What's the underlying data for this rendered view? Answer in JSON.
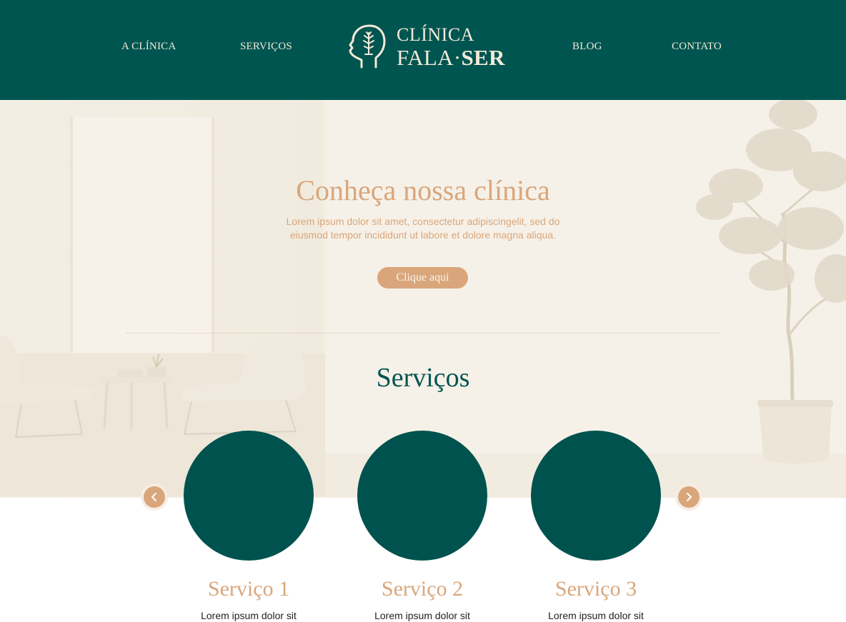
{
  "nav": {
    "items": [
      {
        "label": "A CLÍNICA"
      },
      {
        "label": "SERVIÇOS"
      },
      {
        "label": "BLOG"
      },
      {
        "label": "CONTATO"
      }
    ]
  },
  "logo": {
    "line1": "CLÍNICA",
    "line2_a": "FALA·",
    "line2_b": "SER",
    "icon": "head-with-tree-icon"
  },
  "hero": {
    "title": "Conheça nossa clínica",
    "text": "Lorem ipsum dolor sit amet, consectetur adipiscingelit, sed do eiusmod tempor incididunt ut labore et dolore magna aliqua.",
    "button_label": "Clique aqui"
  },
  "services": {
    "title": "Serviços",
    "items": [
      {
        "title": "Serviço 1",
        "text": "Lorem ipsum dolor sit"
      },
      {
        "title": "Serviço 2",
        "text": "Lorem ipsum dolor sit"
      },
      {
        "title": "Serviço 3",
        "text": "Lorem ipsum dolor sit"
      }
    ],
    "prev_icon": "chevron-left-icon",
    "next_icon": "chevron-right-icon"
  },
  "colors": {
    "primary": "#005550",
    "accent": "#d9a67b",
    "cream": "#f2ead8"
  }
}
